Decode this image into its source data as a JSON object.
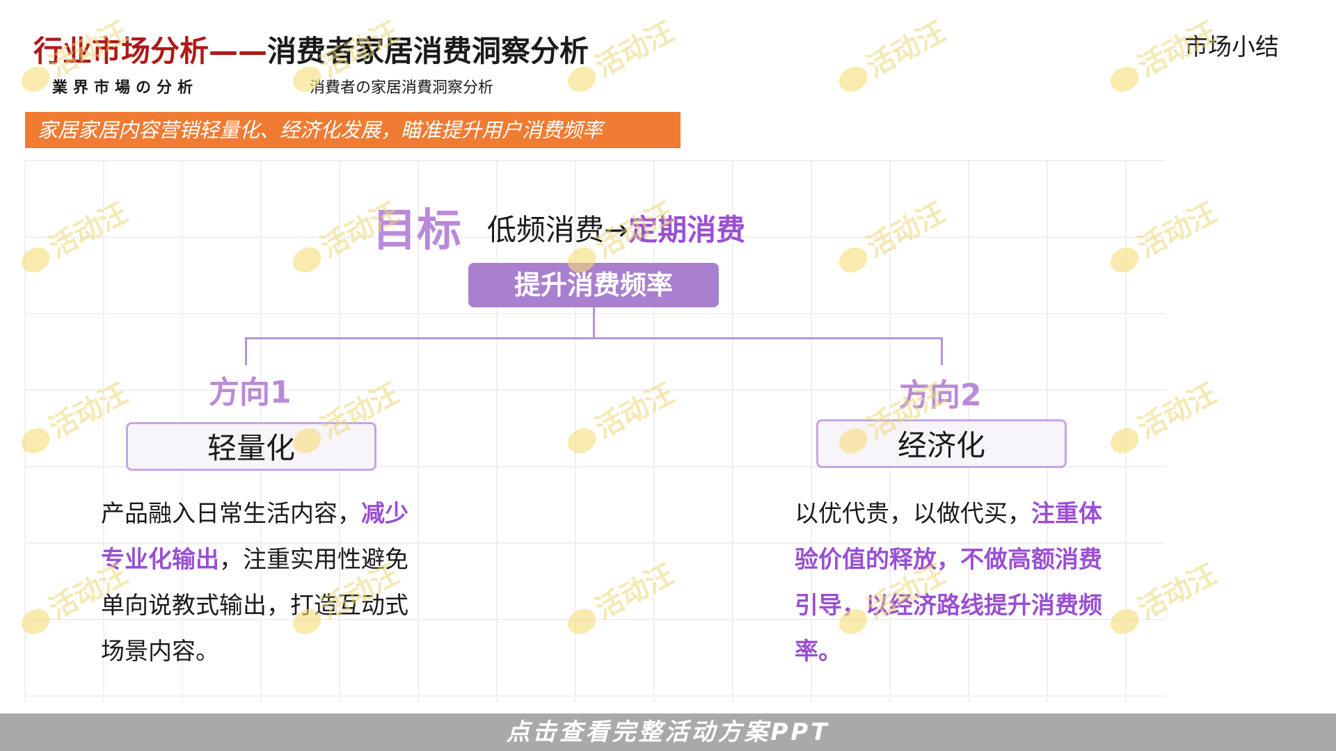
{
  "header": {
    "title_main": "行业市场分析",
    "title_dash": "——",
    "title_sub": "消费者家居消费洞察分析",
    "jp_left": "業界市場の分析",
    "jp_right": "消費者の家居消費洞察分析",
    "corner": "市场小结"
  },
  "banner": "家居家居内容营销轻量化、经济化发展，瞄准提升用户消费频率",
  "goal": {
    "big": "目标",
    "from": "低频消费→",
    "to": "定期消费",
    "center": "提升消费频率"
  },
  "left": {
    "label": "方向1",
    "box": "轻量化",
    "p1": "产品融入日常生活内容，",
    "p1_hl": "减少专业化输出",
    "p2": "，注重实用性避免单向说教式输出，打造互动式场景内容。"
  },
  "right": {
    "label": "方向2",
    "box": "经济化",
    "p1": "以优代贵，以做代买，",
    "p1_hl": "注重体验价值的释放，不做高额消费引导，以经济路线提升消费频率。"
  },
  "footer": "点击查看完整活动方案PPT",
  "watermark": "活动汪"
}
